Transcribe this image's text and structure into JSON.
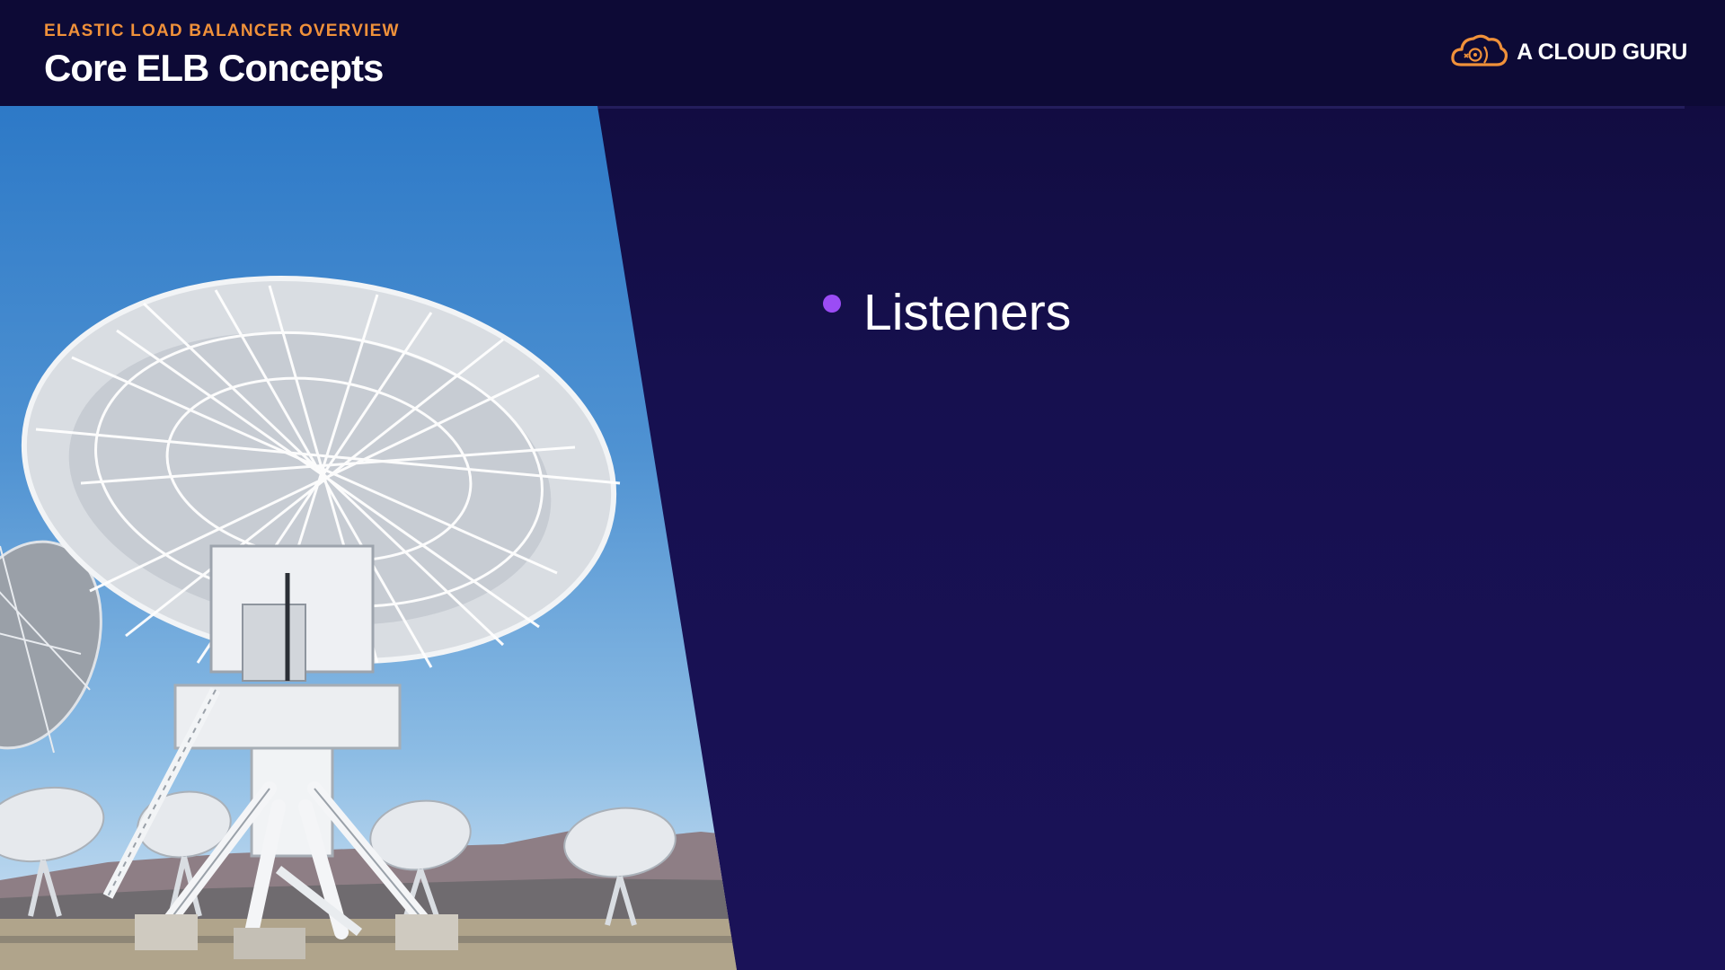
{
  "slide": {
    "subtitle": "ELASTIC LOAD BALANCER OVERVIEW",
    "title": "Core ELB Concepts",
    "brand": {
      "name": "A CLOUD GURU",
      "logo_icon": "cloud-icon",
      "logo_color": "#f0913a"
    },
    "bullets": [
      {
        "text": "Listeners"
      }
    ],
    "image": {
      "subject": "radio-telescope-dish-array-photo"
    }
  },
  "colors": {
    "background": "#16104f",
    "header_background": "#0d0a36",
    "subtitle": "#f0913a",
    "title": "#ffffff",
    "bullet_dot": "#9b4cf5"
  }
}
